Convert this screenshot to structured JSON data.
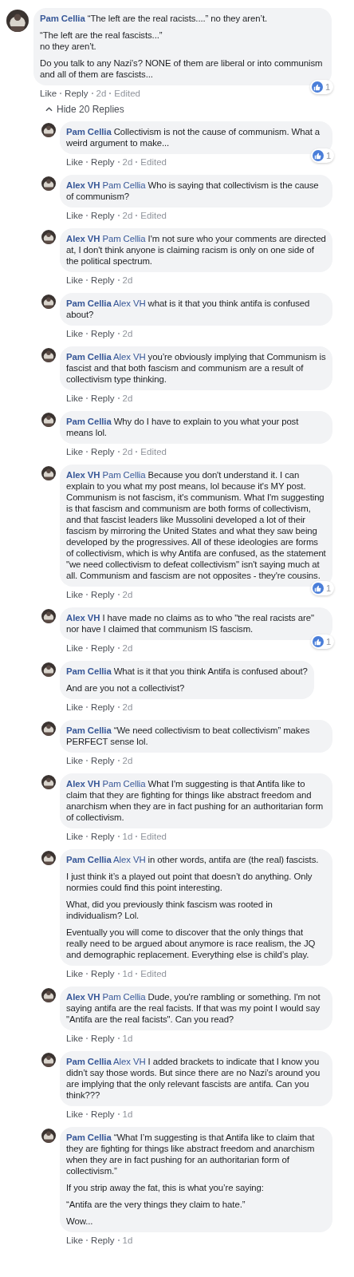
{
  "comment": {
    "author": "Pam Cellia",
    "avatar": {
      "kind": "picture"
    },
    "paragraphs": [
      "“The left are the real racists....” no they aren’t.",
      "“The left are the real fascists...”\nno they aren’t.",
      "Do you talk to any Nazi’s? NONE of them are liberal or into communism and all of them are fascists..."
    ],
    "actions": [
      "Like",
      "Reply"
    ],
    "time": "2d",
    "edited": "Edited",
    "reactions": "1"
  },
  "replies_toggle": {
    "label": "Hide 20 Replies",
    "expanded": true
  },
  "replies": [
    {
      "author": "Pam Cellia",
      "avatar": {
        "kind": "picture"
      },
      "paragraphs": [
        "Collectivism is not the cause of communism. What a weird argument to make..."
      ],
      "actions": [
        "Like",
        "Reply"
      ],
      "time": "2d",
      "edited": "Edited",
      "reactions": "1"
    },
    {
      "author": "Alex VH",
      "mention": "Pam Cellia",
      "avatar": {
        "kind": "picture"
      },
      "paragraphs": [
        "Who is saying that collectivism is the cause of communism?"
      ],
      "actions": [
        "Like",
        "Reply"
      ],
      "time": "2d",
      "edited": "Edited"
    },
    {
      "author": "Alex VH",
      "mention": "Pam Cellia",
      "avatar": {
        "kind": "picture"
      },
      "paragraphs": [
        "I'm not sure who your comments are directed at, I don't think anyone is claiming racism is only on one side of the political spectrum."
      ],
      "actions": [
        "Like",
        "Reply"
      ],
      "time": "2d"
    },
    {
      "author": "Pam Cellia",
      "mention": "Alex VH",
      "avatar": {
        "kind": "picture"
      },
      "paragraphs": [
        "what is it that you think antifa is confused about?"
      ],
      "actions": [
        "Like",
        "Reply"
      ],
      "time": "2d"
    },
    {
      "author": "Pam Cellia",
      "mention": "Alex VH",
      "avatar": {
        "kind": "picture"
      },
      "paragraphs": [
        "you’re obviously implying that Communism is fascist and that both fascism and communism are a result of collectivism type thinking."
      ],
      "actions": [
        "Like",
        "Reply"
      ],
      "time": "2d"
    },
    {
      "author": "Pam Cellia",
      "avatar": {
        "kind": "picture"
      },
      "paragraphs": [
        "Why do I have to explain to you what your post means lol."
      ],
      "actions": [
        "Like",
        "Reply"
      ],
      "time": "2d",
      "edited": "Edited"
    },
    {
      "author": "Alex VH",
      "mention": "Pam Cellia",
      "avatar": {
        "kind": "picture"
      },
      "paragraphs": [
        "Because you don't understand it. I can explain to you what my post means, lol because it's MY post. Communism is not fascism, it's communism. What I'm suggesting is that fascism and communism are both forms of collectivism, and that fascist leaders like Mussolini developed a lot of their fascism by mirroring the United States and what they saw being developed by the progressives. All of these ideologies are forms of collectivism, which is why Antifa are confused, as the statement \"we need collectivism to defeat collectivism\" isn't saying much at all. Communism and fascism are not opposites - they're cousins."
      ],
      "actions": [
        "Like",
        "Reply"
      ],
      "time": "2d",
      "reactions": "1"
    },
    {
      "author": "Alex VH",
      "avatar": {
        "kind": "picture"
      },
      "paragraphs": [
        "I have made no claims as to who \"the real racists are\" nor have I claimed that communism IS fascism."
      ],
      "actions": [
        "Like",
        "Reply"
      ],
      "time": "2d",
      "reactions": "1"
    },
    {
      "author": "Pam Cellia",
      "avatar": {
        "kind": "picture"
      },
      "paragraphs": [
        "What is it that you think Antifa is confused about?",
        "And are you not a collectivist?"
      ],
      "actions": [
        "Like",
        "Reply"
      ],
      "time": "2d"
    },
    {
      "author": "Pam Cellia",
      "avatar": {
        "kind": "picture"
      },
      "paragraphs": [
        "“We need collectivism to beat collectivism” makes PERFECT sense lol."
      ],
      "actions": [
        "Like",
        "Reply"
      ],
      "time": "2d"
    },
    {
      "author": "Alex VH",
      "mention": "Pam Cellia",
      "avatar": {
        "kind": "picture"
      },
      "paragraphs": [
        "What I'm suggesting is that Antifa like to claim that they are fighting for things like abstract freedom and anarchism when they are in fact pushing for an authoritarian form of collectivism."
      ],
      "actions": [
        "Like",
        "Reply"
      ],
      "time": "1d",
      "edited": "Edited"
    },
    {
      "author": "Pam Cellia",
      "mention": "Alex VH",
      "avatar": {
        "kind": "picture"
      },
      "paragraphs": [
        "in other words, antifa are (the real) fascists.",
        "I just think it’s a played out point that doesn’t do anything. Only normies could find this point interesting.",
        "What, did you previously think fascism was rooted in individualism? Lol.",
        "Eventually you will come to discover that the only things that really need to be argued about anymore is race realism, the JQ and demographic replacement. Everything else is child’s play."
      ],
      "actions": [
        "Like",
        "Reply"
      ],
      "time": "1d",
      "edited": "Edited"
    },
    {
      "author": "Alex VH",
      "mention": "Pam Cellia",
      "avatar": {
        "kind": "picture"
      },
      "paragraphs": [
        "Dude, you're rambling or something. I'm not saying antifa are the real facists. If that was my point I would say \"Antifa are the real facists\". Can you read?"
      ],
      "actions": [
        "Like",
        "Reply"
      ],
      "time": "1d"
    },
    {
      "author": "Pam Cellia",
      "mention": "Alex VH",
      "avatar": {
        "kind": "picture"
      },
      "paragraphs": [
        "I added brackets to indicate that I know you didn’t say those words. But since there are no Nazi’s around you are implying that the only relevant fascists are antifa. Can you think???"
      ],
      "actions": [
        "Like",
        "Reply"
      ],
      "time": "1d"
    },
    {
      "author": "Pam Cellia",
      "avatar": {
        "kind": "picture"
      },
      "paragraphs": [
        "“What I’m suggesting is that Antifa like to claim that they are fighting for things like abstract freedom and anarchism when they are in fact pushing for an authoritarian form of collectivism.”",
        "If you strip away the fat, this is what you’re saying:",
        "“Antifa are the very things they claim to hate.”",
        "Wow..."
      ],
      "actions": [
        "Like",
        "Reply"
      ],
      "time": "1d"
    }
  ]
}
